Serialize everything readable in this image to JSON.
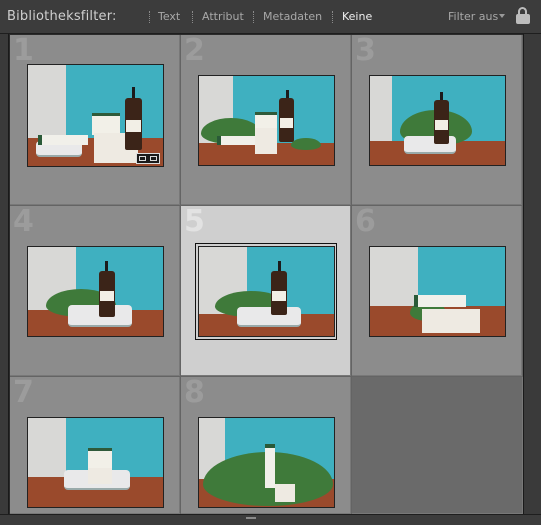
{
  "filter_bar": {
    "label": "Bibliotheksfilter:",
    "tabs": [
      {
        "label": "Text",
        "active": false
      },
      {
        "label": "Attribut",
        "active": false
      },
      {
        "label": "Metadaten",
        "active": false
      },
      {
        "label": "Keine",
        "active": true
      }
    ],
    "preset": "Filter aus",
    "lock_icon": "unlocked-lock-icon"
  },
  "grid": {
    "cells": [
      {
        "index": "1",
        "selected": false,
        "has_badge": true
      },
      {
        "index": "2",
        "selected": false
      },
      {
        "index": "3",
        "selected": false
      },
      {
        "index": "4",
        "selected": false
      },
      {
        "index": "5",
        "selected": true
      },
      {
        "index": "6",
        "selected": false
      },
      {
        "index": "7",
        "selected": false
      },
      {
        "index": "8",
        "selected": false
      }
    ]
  },
  "colors": {
    "cell_bg": "#8c8c8c",
    "selected_bg": "#cfcfcf",
    "empty_bg": "#6a6a6a",
    "teal_wall": "#3fb0c0",
    "table_wood": "#9a4a2c"
  }
}
